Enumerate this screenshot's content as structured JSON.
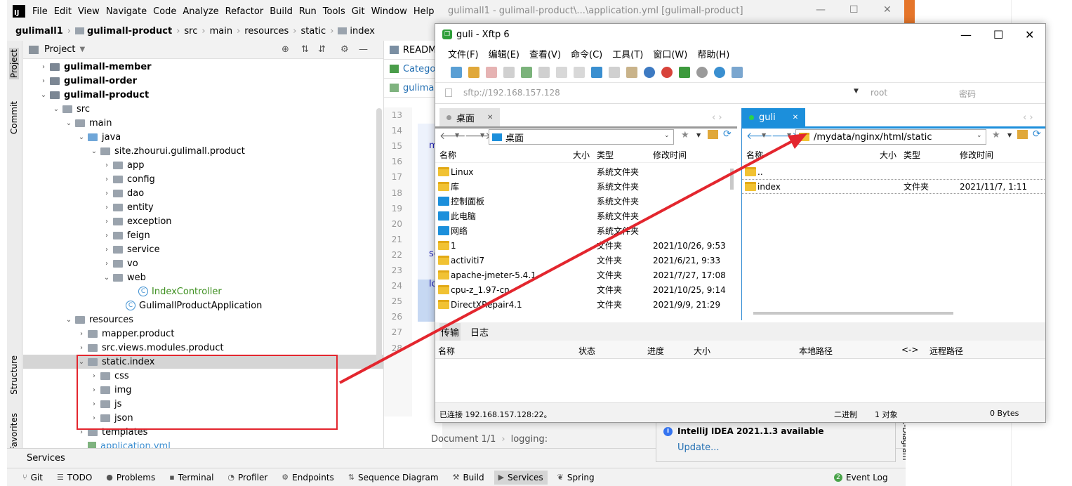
{
  "ide": {
    "logo": "IJ",
    "menu": [
      "File",
      "Edit",
      "View",
      "Navigate",
      "Code",
      "Analyze",
      "Refactor",
      "Build",
      "Run",
      "Tools",
      "Git",
      "Window",
      "Help"
    ],
    "title": "gulimall1 - gulimall-product\\...\\application.yml [gulimall-product]",
    "breadcrumbs": [
      "gulimall1",
      "gulimall-product",
      "src",
      "main",
      "resources",
      "static",
      "index"
    ],
    "project_label": "Project",
    "side_tabs": {
      "project": "Project",
      "commit": "Commit",
      "structure": "Structure",
      "favorites": "Favorites"
    },
    "tree": [
      {
        "label": "gulimall-member",
        "depth": 1,
        "arrow": "›",
        "kind": "module",
        "bold": true
      },
      {
        "label": "gulimall-order",
        "depth": 1,
        "arrow": "›",
        "kind": "module",
        "bold": true
      },
      {
        "label": "gulimall-product",
        "depth": 1,
        "arrow": "⌄",
        "kind": "module",
        "bold": true
      },
      {
        "label": "src",
        "depth": 2,
        "arrow": "⌄",
        "kind": "folder"
      },
      {
        "label": "main",
        "depth": 3,
        "arrow": "⌄",
        "kind": "folder"
      },
      {
        "label": "java",
        "depth": 4,
        "arrow": "⌄",
        "kind": "folder-blue"
      },
      {
        "label": "site.zhourui.gulimall.product",
        "depth": 5,
        "arrow": "⌄",
        "kind": "folder"
      },
      {
        "label": "app",
        "depth": 6,
        "arrow": "›",
        "kind": "folder"
      },
      {
        "label": "config",
        "depth": 6,
        "arrow": "›",
        "kind": "folder"
      },
      {
        "label": "dao",
        "depth": 6,
        "arrow": "›",
        "kind": "folder"
      },
      {
        "label": "entity",
        "depth": 6,
        "arrow": "›",
        "kind": "folder"
      },
      {
        "label": "exception",
        "depth": 6,
        "arrow": "›",
        "kind": "folder"
      },
      {
        "label": "feign",
        "depth": 6,
        "arrow": "›",
        "kind": "folder"
      },
      {
        "label": "service",
        "depth": 6,
        "arrow": "›",
        "kind": "folder"
      },
      {
        "label": "vo",
        "depth": 6,
        "arrow": "›",
        "kind": "folder"
      },
      {
        "label": "web",
        "depth": 6,
        "arrow": "⌄",
        "kind": "folder"
      },
      {
        "label": "IndexController",
        "depth": 8,
        "arrow": "",
        "kind": "class",
        "color": "#3d8f1f"
      },
      {
        "label": "GulimallProductApplication",
        "depth": 7,
        "arrow": "",
        "kind": "class"
      },
      {
        "label": "resources",
        "depth": 3,
        "arrow": "⌄",
        "kind": "folder"
      },
      {
        "label": "mapper.product",
        "depth": 4,
        "arrow": "›",
        "kind": "folder"
      },
      {
        "label": "src.views.modules.product",
        "depth": 4,
        "arrow": "›",
        "kind": "folder"
      },
      {
        "label": "static.index",
        "depth": 4,
        "arrow": "⌄",
        "kind": "folder",
        "selected": true
      },
      {
        "label": "css",
        "depth": 5,
        "arrow": "›",
        "kind": "folder"
      },
      {
        "label": "img",
        "depth": 5,
        "arrow": "›",
        "kind": "folder"
      },
      {
        "label": "js",
        "depth": 5,
        "arrow": "›",
        "kind": "folder"
      },
      {
        "label": "json",
        "depth": 5,
        "arrow": "›",
        "kind": "folder"
      },
      {
        "label": "templates",
        "depth": 4,
        "arrow": "›",
        "kind": "folder"
      },
      {
        "label": "application.yml",
        "depth": 4,
        "arrow": "",
        "kind": "yml",
        "color": "#3d8fd1"
      }
    ],
    "editor_tabs": [
      "README",
      "Category",
      "gulimall-"
    ],
    "line_numbers": [
      "13",
      "14",
      "15",
      "16",
      "17",
      "18",
      "19",
      "20",
      "21",
      "22",
      "23",
      "24",
      "25",
      "26",
      "27",
      "28"
    ],
    "code_fragments": [
      "my",
      "se",
      "lo"
    ],
    "editor_footer": [
      "Document 1/1",
      "logging:"
    ],
    "services_label": "Services",
    "bottom_tools": [
      {
        "label": "Git",
        "icon": "⑂"
      },
      {
        "label": "TODO",
        "icon": "☰"
      },
      {
        "label": "Problems",
        "icon": "●"
      },
      {
        "label": "Terminal",
        "icon": "▪"
      },
      {
        "label": "Profiler",
        "icon": "◔"
      },
      {
        "label": "Endpoints",
        "icon": "⚙"
      },
      {
        "label": "Sequence Diagram",
        "icon": "⇅"
      },
      {
        "label": "Build",
        "icon": "⚒"
      },
      {
        "label": "Services",
        "icon": "▶",
        "active": true
      },
      {
        "label": "Spring",
        "icon": "❦"
      }
    ],
    "event_log": "Event Log",
    "event_log_badge": "2",
    "notification": {
      "title": "IntelliJ IDEA 2021.1.3 available",
      "link": "Update..."
    },
    "diagram_tab": "t-Diagram"
  },
  "xftp": {
    "title": "guli - Xftp 6",
    "menu": [
      "文件(F)",
      "编辑(E)",
      "查看(V)",
      "命令(C)",
      "工具(T)",
      "窗口(W)",
      "帮助(H)"
    ],
    "address": "sftp://192.168.157.128",
    "user_placeholder": "root",
    "password_placeholder": "密码",
    "left": {
      "tab": "桌面",
      "path": "桌面",
      "columns": [
        "名称",
        "大小",
        "类型",
        "修改时间"
      ],
      "files": [
        {
          "name": "Linux",
          "size": "",
          "type": "系统文件夹",
          "time": "",
          "icon": "yel"
        },
        {
          "name": "库",
          "size": "",
          "type": "系统文件夹",
          "time": "",
          "icon": "yel"
        },
        {
          "name": "控制面板",
          "size": "",
          "type": "系统文件夹",
          "time": "",
          "icon": "blu"
        },
        {
          "name": "此电脑",
          "size": "",
          "type": "系统文件夹",
          "time": "",
          "icon": "blu"
        },
        {
          "name": "网络",
          "size": "",
          "type": "系统文件夹",
          "time": "",
          "icon": "blu"
        },
        {
          "name": "1",
          "size": "",
          "type": "文件夹",
          "time": "2021/10/26, 9:53",
          "icon": "yel"
        },
        {
          "name": "activiti7",
          "size": "",
          "type": "文件夹",
          "time": "2021/6/21, 9:33",
          "icon": "yel"
        },
        {
          "name": "apache-jmeter-5.4.1",
          "size": "",
          "type": "文件夹",
          "time": "2021/7/27, 17:08",
          "icon": "yel"
        },
        {
          "name": "cpu-z_1.97-cn",
          "size": "",
          "type": "文件夹",
          "time": "2021/10/25, 9:14",
          "icon": "yel"
        },
        {
          "name": "DirectXRepair4.1",
          "size": "",
          "type": "文件夹",
          "time": "2021/9/9, 21:29",
          "icon": "yel"
        }
      ]
    },
    "right": {
      "tab": "guli",
      "path": "/mydata/nginx/html/static",
      "columns": [
        "名称",
        "大小",
        "类型",
        "修改时间"
      ],
      "files": [
        {
          "name": "..",
          "size": "",
          "type": "",
          "time": ""
        },
        {
          "name": "index",
          "size": "",
          "type": "文件夹",
          "time": "2021/11/7, 1:11"
        }
      ]
    },
    "transfer": {
      "tabs": [
        "传输",
        "日志"
      ],
      "columns": [
        "名称",
        "状态",
        "进度",
        "大小",
        "本地路径",
        "<->",
        "远程路径"
      ]
    },
    "status": {
      "connection": "已连接 192.168.157.128:22。",
      "mode": "二进制",
      "objects": "1 对象",
      "size": "0 Bytes"
    }
  },
  "colors": {
    "annotation_red": "#e3262e",
    "xftp_tab_blue": "#1c8fdb"
  }
}
